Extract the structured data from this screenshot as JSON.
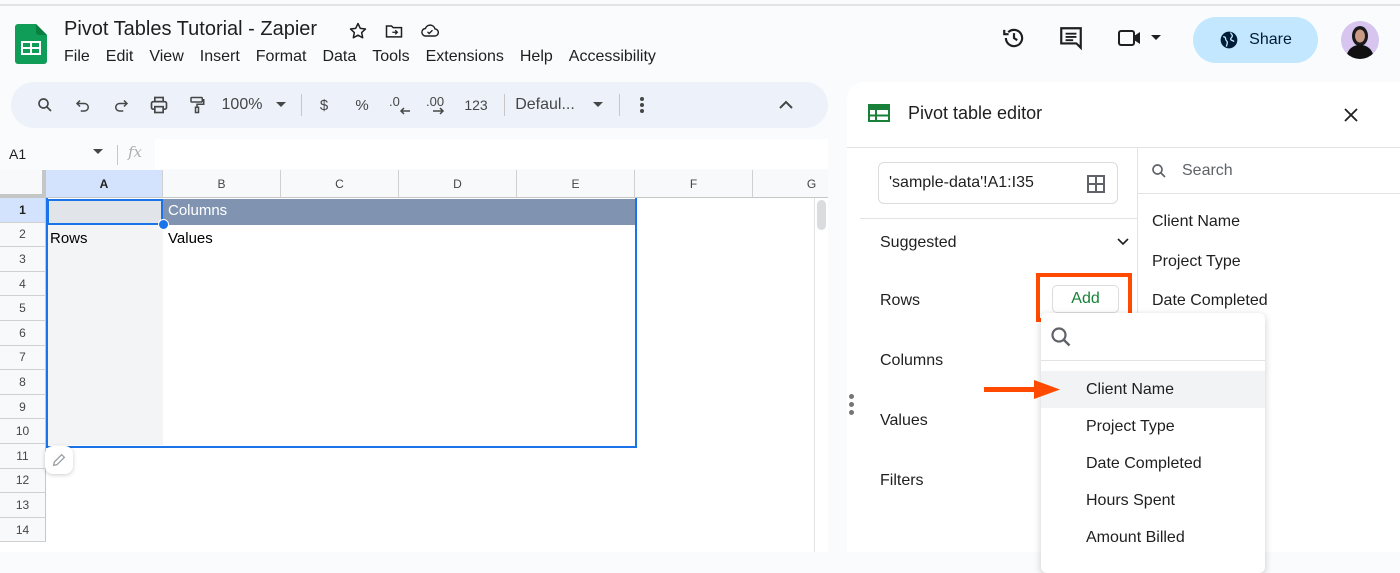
{
  "header": {
    "doc_title": "Pivot Tables Tutorial - Zapier",
    "menu": [
      "File",
      "Edit",
      "View",
      "Insert",
      "Format",
      "Data",
      "Tools",
      "Extensions",
      "Help",
      "Accessibility"
    ],
    "share_label": "Share",
    "colors": {
      "share_bg": "#c2e7ff",
      "logo_green": "#0f9d58"
    }
  },
  "toolbar": {
    "zoom": "100%",
    "currency": "$",
    "percent": "%",
    "decrease_decimal": ".0",
    "increase_decimal": ".00",
    "number_format": "123",
    "font": "Defaul..."
  },
  "formula_bar": {
    "name_box": "A1",
    "fx": "fx",
    "value": ""
  },
  "grid": {
    "columns": [
      "A",
      "B",
      "C",
      "D",
      "E",
      "F",
      "G"
    ],
    "rows": [
      "1",
      "2",
      "3",
      "4",
      "5",
      "6",
      "7",
      "8",
      "9",
      "10",
      "11",
      "12",
      "13",
      "14"
    ],
    "selected_cell": "A1",
    "cells": {
      "B1": "Columns",
      "A2": "Rows",
      "B2": "Values"
    },
    "colors": {
      "pivot_header": "#8094b2",
      "selection": "#1a73e8"
    }
  },
  "pivot_editor": {
    "title": "Pivot table editor",
    "range": "'sample-data'!A1:I35",
    "sections": [
      "Suggested",
      "Rows",
      "Columns",
      "Values",
      "Filters"
    ],
    "add_label": "Add",
    "field_search_placeholder": "Search",
    "fields": [
      "Client Name",
      "Project Type",
      "Date Completed"
    ],
    "dropdown": {
      "search_value": "",
      "items": [
        "Client Name",
        "Project Type",
        "Date Completed",
        "Hours Spent",
        "Amount Billed"
      ],
      "highlighted": "Client Name"
    },
    "annotation_color": "#ff4a00"
  }
}
